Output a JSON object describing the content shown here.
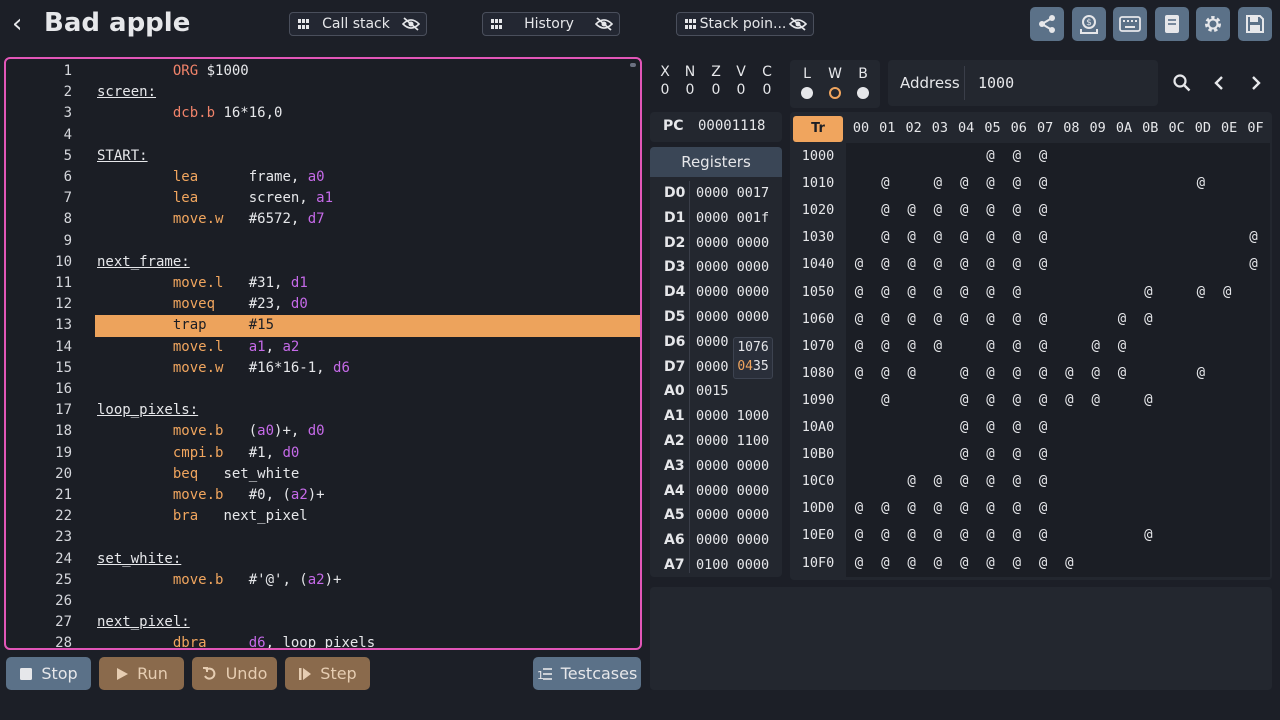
{
  "app": {
    "title": "Bad apple"
  },
  "toolbar": {
    "panels": [
      {
        "label": "Call stack"
      },
      {
        "label": "History"
      },
      {
        "label": "Stack poin..."
      }
    ],
    "icons": [
      "share-icon",
      "deposit-icon",
      "keyboard-icon",
      "book-icon",
      "gear-icon",
      "save-icon"
    ]
  },
  "editor": {
    "highlighted_line": 13,
    "lines": [
      {
        "n": "1",
        "label": "",
        "op": "ORG",
        "args": "$1000",
        "kind": "dir"
      },
      {
        "n": "2",
        "label": "screen:",
        "op": "",
        "args": ""
      },
      {
        "n": "3",
        "label": "",
        "op": "dcb.b",
        "args": "16*16,0",
        "kind": "dir"
      },
      {
        "n": "4",
        "label": "",
        "op": "",
        "args": ""
      },
      {
        "n": "5",
        "label": "START:",
        "op": "",
        "args": ""
      },
      {
        "n": "6",
        "label": "",
        "op": "lea",
        "args": "frame, a0"
      },
      {
        "n": "7",
        "label": "",
        "op": "lea",
        "args": "screen, a1"
      },
      {
        "n": "8",
        "label": "",
        "op": "move.w",
        "args": "#6572, d7"
      },
      {
        "n": "9",
        "label": "",
        "op": "",
        "args": ""
      },
      {
        "n": "10",
        "label": "next_frame:",
        "op": "",
        "args": ""
      },
      {
        "n": "11",
        "label": "",
        "op": "move.l",
        "args": "#31, d1"
      },
      {
        "n": "12",
        "label": "",
        "op": "moveq",
        "args": "#23, d0"
      },
      {
        "n": "13",
        "label": "",
        "op": "trap",
        "args": "#15"
      },
      {
        "n": "14",
        "label": "",
        "op": "move.l",
        "args": "a1, a2"
      },
      {
        "n": "15",
        "label": "",
        "op": "move.w",
        "args": "#16*16-1, d6"
      },
      {
        "n": "16",
        "label": "",
        "op": "",
        "args": ""
      },
      {
        "n": "17",
        "label": "loop_pixels:",
        "op": "",
        "args": ""
      },
      {
        "n": "18",
        "label": "",
        "op": "move.b",
        "args": "(a0)+, d0"
      },
      {
        "n": "19",
        "label": "",
        "op": "cmpi.b",
        "args": "#1, d0"
      },
      {
        "n": "20",
        "label": "",
        "op": "beq",
        "args": "set_white"
      },
      {
        "n": "21",
        "label": "",
        "op": "move.b",
        "args": "#0, (a2)+"
      },
      {
        "n": "22",
        "label": "",
        "op": "bra",
        "args": "next_pixel"
      },
      {
        "n": "23",
        "label": "",
        "op": "",
        "args": ""
      },
      {
        "n": "24",
        "label": "set_white:",
        "op": "",
        "args": ""
      },
      {
        "n": "25",
        "label": "",
        "op": "move.b",
        "args": "#'@', (a2)+"
      },
      {
        "n": "26",
        "label": "",
        "op": "",
        "args": ""
      },
      {
        "n": "27",
        "label": "next_pixel:",
        "op": "",
        "args": ""
      },
      {
        "n": "28",
        "label": "",
        "op": "dbra",
        "args": "d6, loop_pixels"
      }
    ]
  },
  "controls": {
    "stop": "Stop",
    "run": "Run",
    "undo": "Undo",
    "step": "Step",
    "testcases": "Testcases"
  },
  "flags": {
    "names": [
      "X",
      "N",
      "Z",
      "V",
      "C"
    ],
    "values": [
      "0",
      "0",
      "0",
      "0",
      "0"
    ]
  },
  "lwb": {
    "labels": [
      "L",
      "W",
      "B"
    ],
    "selected": "W"
  },
  "memory_nav": {
    "address_label": "Address",
    "address_value": "1000"
  },
  "pc": {
    "label": "PC",
    "value": "00001118"
  },
  "registers": {
    "title": "Registers",
    "rows": [
      {
        "name": "D0",
        "hi": "0000",
        "lo": "0017"
      },
      {
        "name": "D1",
        "hi": "0000",
        "lo": "001f"
      },
      {
        "name": "D2",
        "hi": "0000",
        "lo": "0000"
      },
      {
        "name": "D3",
        "hi": "0000",
        "lo": "0000"
      },
      {
        "name": "D4",
        "hi": "0000",
        "lo": "0000"
      },
      {
        "name": "D5",
        "hi": "0000",
        "lo": "0000"
      },
      {
        "name": "D6",
        "hi": "0000",
        "lo": ""
      },
      {
        "name": "D7",
        "hi": "0000",
        "lo": ""
      },
      {
        "name": "A0",
        "hi": "0015",
        "lo": ""
      },
      {
        "name": "A1",
        "hi": "0000",
        "lo": "1000"
      },
      {
        "name": "A2",
        "hi": "0000",
        "lo": "1100"
      },
      {
        "name": "A3",
        "hi": "0000",
        "lo": "0000"
      },
      {
        "name": "A4",
        "hi": "0000",
        "lo": "0000"
      },
      {
        "name": "A5",
        "hi": "0000",
        "lo": "0000"
      },
      {
        "name": "A6",
        "hi": "0000",
        "lo": "0000"
      },
      {
        "name": "A7",
        "hi": "0100",
        "lo": "0000"
      }
    ],
    "tooltip": {
      "line1": "1076",
      "line2_hi": "04",
      "line2_rest": "35"
    }
  },
  "memory": {
    "corner": "Tr",
    "columns": [
      "00",
      "01",
      "02",
      "03",
      "04",
      "05",
      "06",
      "07",
      "08",
      "09",
      "0A",
      "0B",
      "0C",
      "0D",
      "0E",
      "0F"
    ],
    "rows": [
      {
        "addr": "1000",
        "cells": [
          0,
          0,
          0,
          0,
          0,
          1,
          1,
          1,
          0,
          0,
          0,
          0,
          0,
          0,
          0,
          0
        ]
      },
      {
        "addr": "1010",
        "cells": [
          0,
          1,
          0,
          1,
          1,
          1,
          1,
          1,
          0,
          0,
          0,
          0,
          0,
          1,
          0,
          0
        ]
      },
      {
        "addr": "1020",
        "cells": [
          0,
          1,
          1,
          1,
          1,
          1,
          1,
          1,
          0,
          0,
          0,
          0,
          0,
          0,
          0,
          0
        ]
      },
      {
        "addr": "1030",
        "cells": [
          0,
          1,
          1,
          1,
          1,
          1,
          1,
          1,
          0,
          0,
          0,
          0,
          0,
          0,
          0,
          1
        ]
      },
      {
        "addr": "1040",
        "cells": [
          1,
          1,
          1,
          1,
          1,
          1,
          1,
          1,
          0,
          0,
          0,
          0,
          0,
          0,
          0,
          1
        ]
      },
      {
        "addr": "1050",
        "cells": [
          1,
          1,
          1,
          1,
          1,
          1,
          1,
          0,
          0,
          0,
          0,
          1,
          0,
          1,
          1,
          0
        ]
      },
      {
        "addr": "1060",
        "cells": [
          1,
          1,
          1,
          1,
          1,
          1,
          1,
          1,
          0,
          0,
          1,
          1,
          0,
          0,
          0,
          0
        ]
      },
      {
        "addr": "1070",
        "cells": [
          1,
          1,
          1,
          1,
          0,
          1,
          1,
          1,
          0,
          1,
          1,
          0,
          0,
          0,
          0,
          0
        ]
      },
      {
        "addr": "1080",
        "cells": [
          1,
          1,
          1,
          0,
          1,
          1,
          1,
          1,
          1,
          1,
          1,
          0,
          0,
          1,
          0,
          0
        ]
      },
      {
        "addr": "1090",
        "cells": [
          0,
          1,
          0,
          0,
          1,
          1,
          1,
          1,
          1,
          1,
          0,
          1,
          0,
          0,
          0,
          0
        ]
      },
      {
        "addr": "10A0",
        "cells": [
          0,
          0,
          0,
          0,
          1,
          1,
          1,
          1,
          0,
          0,
          0,
          0,
          0,
          0,
          0,
          0
        ]
      },
      {
        "addr": "10B0",
        "cells": [
          0,
          0,
          0,
          0,
          1,
          1,
          1,
          1,
          0,
          0,
          0,
          0,
          0,
          0,
          0,
          0
        ]
      },
      {
        "addr": "10C0",
        "cells": [
          0,
          0,
          1,
          1,
          1,
          1,
          1,
          1,
          0,
          0,
          0,
          0,
          0,
          0,
          0,
          0
        ]
      },
      {
        "addr": "10D0",
        "cells": [
          1,
          1,
          1,
          1,
          1,
          1,
          1,
          1,
          0,
          0,
          0,
          0,
          0,
          0,
          0,
          0
        ]
      },
      {
        "addr": "10E0",
        "cells": [
          1,
          1,
          1,
          1,
          1,
          1,
          1,
          1,
          0,
          0,
          0,
          1,
          0,
          0,
          0,
          0
        ]
      },
      {
        "addr": "10F0",
        "cells": [
          1,
          1,
          1,
          1,
          1,
          1,
          1,
          1,
          1,
          0,
          0,
          0,
          0,
          0,
          0,
          0
        ]
      }
    ],
    "glyph": "@"
  },
  "colors": {
    "accent_orange": "#f0a55e",
    "editor_border": "#e256b8",
    "button_slate": "#5b7188",
    "button_brown": "#8a6a4c",
    "register_purple": "#c56ae8"
  }
}
